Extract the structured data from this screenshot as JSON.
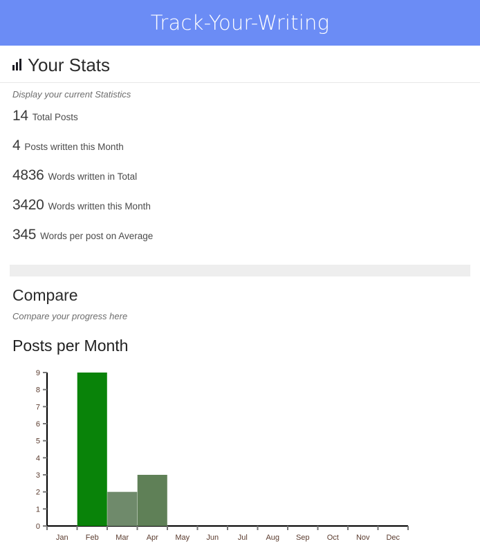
{
  "app": {
    "title": "Track-Your-Writing",
    "header_color": "#6b8cf5"
  },
  "stats_section": {
    "icon": "bar-chart-icon",
    "heading": "Your Stats",
    "subtitle": "Display your current Statistics",
    "items": [
      {
        "value": "14",
        "label": "Total Posts"
      },
      {
        "value": "4",
        "label": "Posts written this Month"
      },
      {
        "value": "4836",
        "label": "Words written in Total"
      },
      {
        "value": "3420",
        "label": "Words written this Month"
      },
      {
        "value": "345",
        "label": "Words per post on Average"
      }
    ]
  },
  "compare_section": {
    "heading": "Compare",
    "subtitle": "Compare your progress here",
    "chart_heading": "Posts per Month"
  },
  "chart_data": {
    "type": "bar",
    "title": "Posts per Month",
    "xlabel": "",
    "ylabel": "",
    "categories": [
      "Jan",
      "Feb",
      "Mar",
      "Apr",
      "May",
      "Jun",
      "Jul",
      "Aug",
      "Sep",
      "Oct",
      "Nov",
      "Dec"
    ],
    "values": [
      0,
      9,
      2,
      3,
      0,
      0,
      0,
      0,
      0,
      0,
      0,
      0
    ],
    "bar_colors": [
      "#098309",
      "#098309",
      "#6f8a6b",
      "#5f8057",
      "#098309",
      "#098309",
      "#098309",
      "#098309",
      "#098309",
      "#098309",
      "#098309",
      "#098309"
    ],
    "ylim": [
      0,
      9
    ],
    "yticks": [
      "0",
      "1",
      "2",
      "3",
      "4",
      "5",
      "6",
      "7",
      "8",
      "9"
    ],
    "grid": false,
    "legend": false,
    "axis_color": "#000000",
    "tick_label_color": "#5a3b2e"
  }
}
